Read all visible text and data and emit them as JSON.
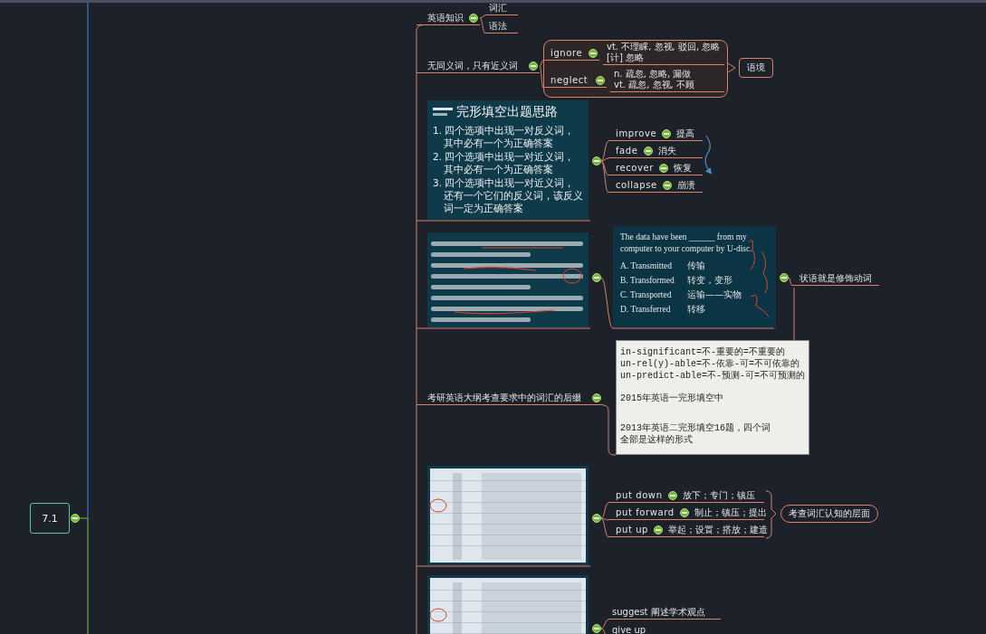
{
  "root": {
    "label": "7.1",
    "expanded": true
  },
  "branches": [
    {
      "kind": "topic",
      "label": "英语知识",
      "expanded": true,
      "children": [
        {
          "kind": "label",
          "label": "词汇"
        },
        {
          "kind": "label",
          "label": "语法"
        }
      ]
    },
    {
      "kind": "topic",
      "label": "无同义词，只有近义词",
      "expanded": true,
      "summary": "语境",
      "children": [
        {
          "kind": "word",
          "label": "ignore",
          "expanded": true,
          "meaning": [
            "vt. 不理睬, 忽视, 驳回, 忽略",
            "[计] 忽略"
          ]
        },
        {
          "kind": "word",
          "label": "neglect",
          "expanded": true,
          "meaning": [
            "n. 疏忽, 忽略, 漏做",
            "vt. 疏忽, 忽视, 不顾"
          ]
        }
      ]
    },
    {
      "kind": "slide",
      "title": "完形填空出题思路",
      "expanded": true,
      "items": [
        "1. 四个选项中出现一对反义词，其中必有一个为正确答案",
        "2. 四个选项中出现一对近义词，其中必有一个为正确答案",
        "3. 四个选项中出现一对近义词，还有一个它们的反义词，该反义词一定为正确答案"
      ],
      "children": [
        {
          "kind": "word",
          "label": "improve",
          "expanded": true,
          "meaning": "提高"
        },
        {
          "kind": "word",
          "label": "fade",
          "expanded": true,
          "meaning": "消失"
        },
        {
          "kind": "word",
          "label": "recover",
          "expanded": true,
          "meaning": "恢复"
        },
        {
          "kind": "word",
          "label": "collapse",
          "expanded": true,
          "meaning": "崩溃"
        }
      ]
    },
    {
      "kind": "picture",
      "expanded": true,
      "children": [
        {
          "kind": "question",
          "question": "The data have been ______ from my computer to your computer by U-disc.",
          "expanded": true,
          "options": [
            {
              "label": "A. Transmitted",
              "note": "传输"
            },
            {
              "label": "B. Transformed",
              "note": "转变，变形"
            },
            {
              "label": "C. Transported",
              "note": "运输——实物"
            },
            {
              "label": "D. Transferred",
              "note": "转移"
            }
          ],
          "children": [
            {
              "label": "状语就是修饰动词"
            }
          ]
        }
      ]
    },
    {
      "kind": "topic",
      "label": "考研英语大纲考查要求中的词汇的后缀",
      "expanded": true,
      "children": [
        {
          "kind": "note",
          "lines": [
            "in-significant=不-重要的=不重要的",
            "un-rel(y)-able=不-依靠-可=不可依靠的",
            "un-predict-able=不-预测-可=不可预测的",
            "2015年英语一完形填空中",
            "2013年英语二完形填空16题，四个词",
            "全部是这样的形式"
          ]
        }
      ]
    },
    {
      "kind": "picture",
      "expanded": true,
      "summary": "考查词汇认知的层面",
      "children": [
        {
          "kind": "word",
          "label": "put down",
          "expanded": true,
          "meaning": "放下；专门；镇压"
        },
        {
          "kind": "word",
          "label": "put forward",
          "expanded": true,
          "meaning": "制止；镇压；提出"
        },
        {
          "kind": "word",
          "label": "put up",
          "expanded": true,
          "meaning": "举起；设置；搭放；建造"
        }
      ]
    },
    {
      "kind": "picture",
      "expanded": true,
      "children": [
        {
          "kind": "label",
          "label": "suggest 阐述学术观点"
        },
        {
          "kind": "label",
          "label": "give up"
        }
      ]
    }
  ]
}
